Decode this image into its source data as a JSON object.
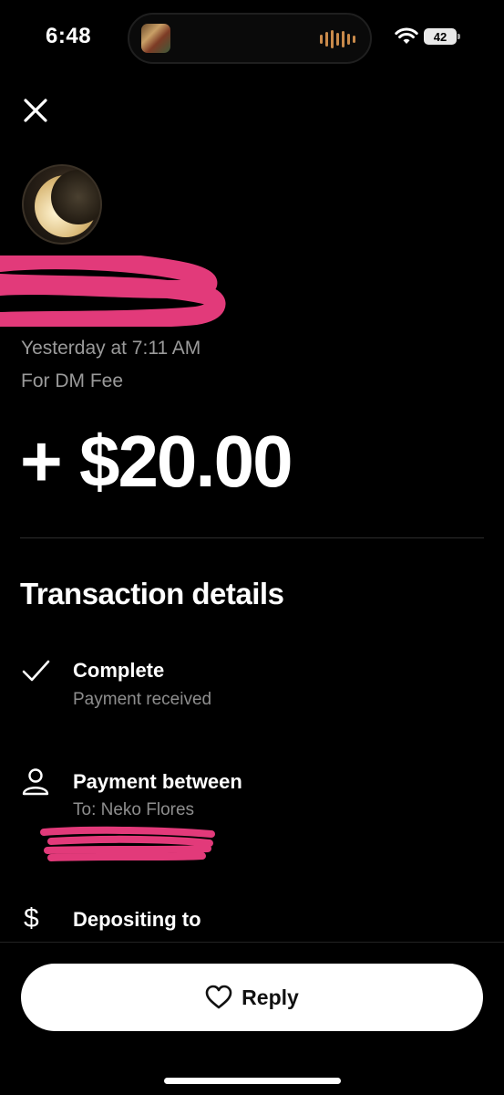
{
  "status_bar": {
    "time": "6:48",
    "battery": "42"
  },
  "transaction": {
    "date": "Yesterday at 7:11 AM",
    "note": "For DM Fee",
    "amount": "+ $20.00"
  },
  "details": {
    "title": "Transaction details",
    "items": [
      {
        "icon": "checkmark-icon",
        "title": "Complete",
        "subtitle": "Payment received"
      },
      {
        "icon": "person-icon",
        "title": "Payment between",
        "subtitle": "To: Neko Flores"
      },
      {
        "icon": "dollar-icon",
        "title": "Depositing to",
        "subtitle": ""
      }
    ]
  },
  "actions": {
    "reply_label": "Reply"
  },
  "colors": {
    "background": "#000000",
    "secondary_text": "#9a9a9a",
    "redaction": "#e23a7a",
    "button_bg": "#ffffff"
  }
}
